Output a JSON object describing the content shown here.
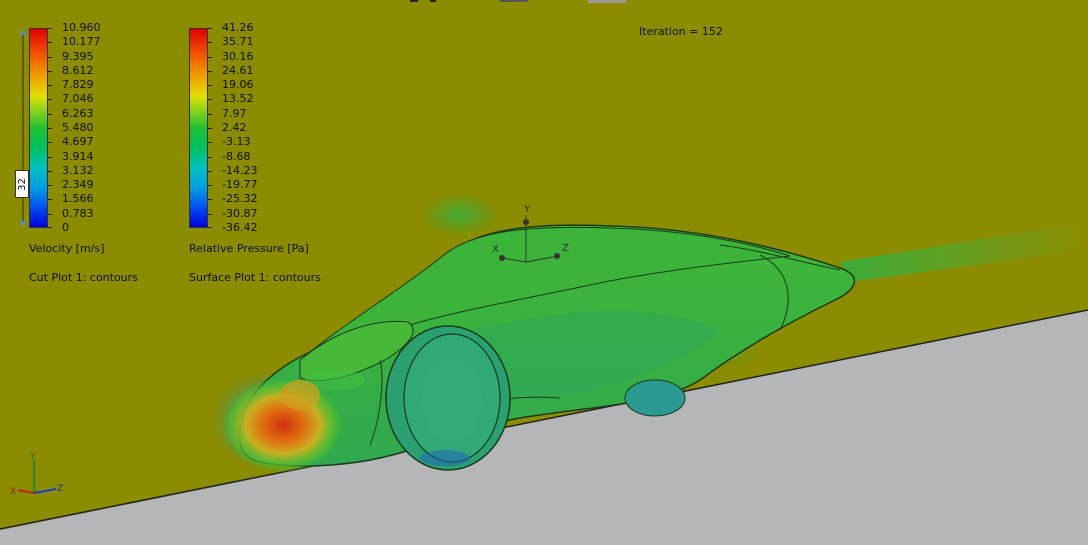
{
  "velocity_scale": {
    "labels": [
      "10.960",
      "10.177",
      "9.395",
      "8.612",
      "7.829",
      "7.046",
      "6.263",
      "5.480",
      "4.697",
      "3.914",
      "3.132",
      "2.349",
      "1.566",
      "0.783",
      "0"
    ],
    "title": "Velocity [m/s]",
    "plot_name": "Cut Plot 1: contours",
    "slider_value": "32"
  },
  "pressure_scale": {
    "labels": [
      "41.26",
      "35.71",
      "30.16",
      "24.61",
      "19.06",
      "13.52",
      "7.97",
      "2.42",
      "-3.13",
      "-8.68",
      "-14.23",
      "-19.77",
      "-25.32",
      "-30.87",
      "-36.42"
    ],
    "title": "Relative Pressure [Pa]",
    "plot_name": "Surface Plot 1: contours"
  },
  "iteration_text": "Iteration = 152",
  "model_axes": {
    "x": "X",
    "y": "Y",
    "z": "Z"
  },
  "corner_axes": {
    "x": "X",
    "y": "Y",
    "z": "Z"
  },
  "colors": {
    "background": "#8c8c00",
    "ground": "#b4b6b7",
    "bar_max": "#e00000",
    "bar_min": "#0000e0"
  }
}
